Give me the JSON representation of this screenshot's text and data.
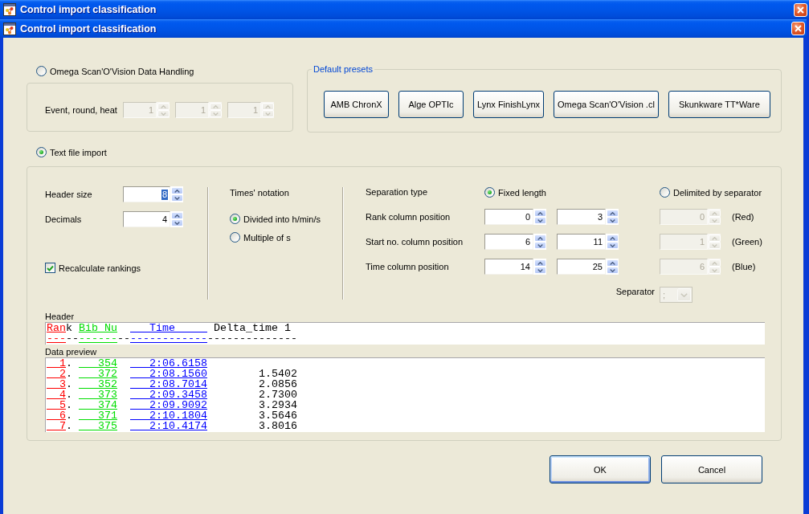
{
  "background_window": {
    "title": "Control import classification"
  },
  "window": {
    "title": "Control import classification"
  },
  "omega_handling": {
    "label": "Omega Scan'O'Vision Data Handling",
    "selected": false,
    "event_label": "Event, round, heat",
    "event_fields": [
      {
        "value": "1",
        "disabled": true
      },
      {
        "value": "1",
        "disabled": true
      },
      {
        "value": "1",
        "disabled": true
      }
    ]
  },
  "default_presets": {
    "title": "Default presets",
    "buttons": [
      "AMB ChronX",
      "Alge OPTIc",
      "Lynx FinishLynx",
      "Omega Scan'O'Vision .cl",
      "Skunkware TT*Ware"
    ]
  },
  "text_file_import": {
    "label": "Text file import",
    "selected": true,
    "fields": [
      {
        "label": "Header size",
        "value": "8",
        "focused": true
      },
      {
        "label": "Decimals",
        "value": "4",
        "focused": false
      }
    ],
    "recalculate_rankings": {
      "label": "Recalculate rankings",
      "checked": true
    },
    "times_notation": {
      "title": "Times' notation",
      "options": [
        {
          "label": "Divided into h/min/s",
          "selected": true
        },
        {
          "label": "Multiple of s",
          "selected": false
        }
      ]
    },
    "separation_type": {
      "title": "Separation type",
      "options": [
        {
          "label": "Fixed length",
          "selected": true
        },
        {
          "label": "Delimited by separator",
          "selected": false
        }
      ]
    },
    "columns": [
      {
        "label": "Rank column position",
        "start": "0",
        "end": "3",
        "delimited_index": {
          "value": "0",
          "disabled": true
        },
        "color_name": "(Red)",
        "color": "#ff0000"
      },
      {
        "label": "Start no. column position",
        "start": "6",
        "end": "11",
        "delimited_index": {
          "value": "1",
          "disabled": true
        },
        "color_name": "(Green)",
        "color": "#00dd00"
      },
      {
        "label": "Time column position",
        "start": "14",
        "end": "25",
        "delimited_index": {
          "value": "6",
          "disabled": true
        },
        "color_name": "(Blue)",
        "color": "#0000ff"
      }
    ],
    "separator": {
      "label": "Separator",
      "value": ";",
      "disabled": true
    },
    "header": {
      "title": "Header",
      "lines": [
        "Rank Bib Nu     Time      Delta_time 1",
        "---------------------------------------"
      ]
    },
    "data_preview": {
      "title": "Data preview",
      "lines": [
        "  1.    354     2:06.6158",
        "  2.    372     2:08.1560        1.5402",
        "  3.    352     2:08.7014        2.0856",
        "  4.    373     2:09.3458        2.7300",
        "  5.    374     2:09.9092        3.2934",
        "  6.    371     2:10.1804        3.5646",
        "  7.    375     2:10.4174        3.8016"
      ]
    }
  },
  "buttons": [
    {
      "label": "OK",
      "default": true
    },
    {
      "label": "Cancel",
      "default": false
    }
  ]
}
